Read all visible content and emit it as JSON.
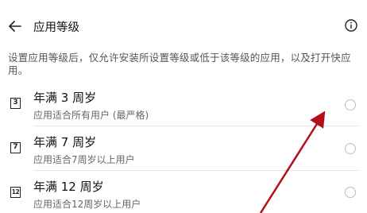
{
  "header": {
    "title": "应用等级",
    "back_icon": "back-arrow-icon",
    "info_icon": "info-icon"
  },
  "description": "设置应用等级后，仅允许安装所设置等级或低于该等级的应用，以及打开快应用。",
  "options": [
    {
      "icon_text": "3",
      "title": "年满 3 周岁",
      "subtitle": "应用适合所有用户 (最严格)",
      "selected": false
    },
    {
      "icon_text": "7",
      "title": "年满 7 周岁",
      "subtitle": "应用适合7周岁以上用户",
      "selected": false
    },
    {
      "icon_text": "12",
      "title": "年满 12 周岁",
      "subtitle": "应用适合12周岁以上用户",
      "selected": false
    }
  ],
  "colors": {
    "annotation_arrow": "#b3101a",
    "radio_border": "#bdbdbd"
  }
}
